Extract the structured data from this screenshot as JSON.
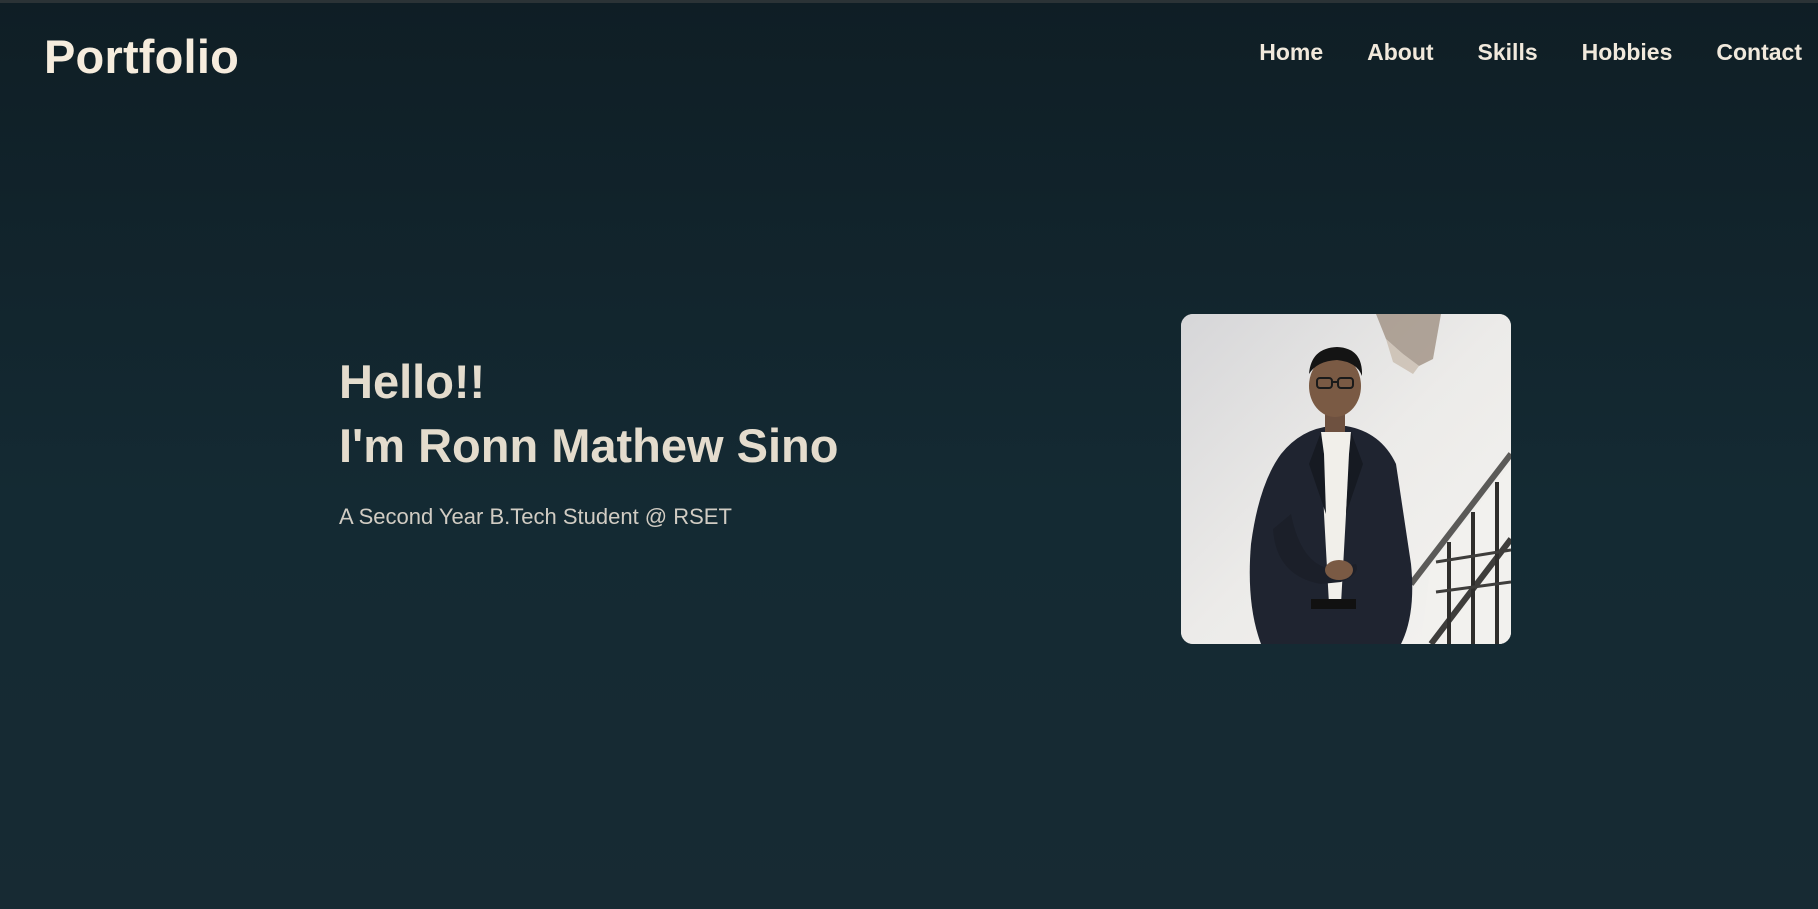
{
  "header": {
    "brand": "Portfolio",
    "nav": [
      {
        "label": "Home"
      },
      {
        "label": "About"
      },
      {
        "label": "Skills"
      },
      {
        "label": "Hobbies"
      },
      {
        "label": "Contact"
      }
    ]
  },
  "hero": {
    "greeting": "Hello!!",
    "name": "I'm Ronn Mathew Sino",
    "tagline": "A Second Year B.Tech Student @ RSET"
  },
  "colors": {
    "background_top": "#0f1e25",
    "background_bottom": "#172a33",
    "text_primary": "#eae3d6"
  }
}
